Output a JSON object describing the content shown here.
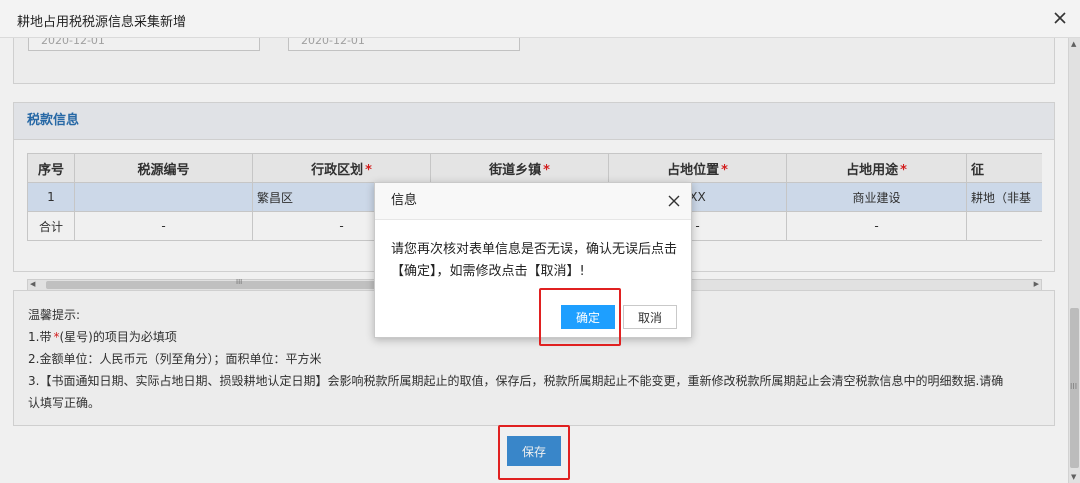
{
  "window": {
    "title": "耕地占用税税源信息采集新增"
  },
  "dates": {
    "date1": "2020-12-01",
    "date2": "2020-12-01"
  },
  "tax_section": {
    "title": "税款信息",
    "columns": [
      "序号",
      "税源编号",
      "行政区划",
      "街道乡镇",
      "占地位置",
      "占地用途",
      "征"
    ],
    "required_mark": "*",
    "rows": [
      [
        "1",
        "",
        "繁昌区",
        "",
        "XX",
        "商业建设",
        "耕地（非基"
      ],
      [
        "合计",
        "-",
        "-",
        "",
        "-",
        "-",
        ""
      ]
    ]
  },
  "scrollbar": {
    "grip": "III"
  },
  "tips": {
    "title": "温馨提示:",
    "line1_a": "1.带",
    "line1_b": "(星号)的项目为必填项",
    "line2": "2.金额单位：人民币元（列至角分）；面积单位：平方米",
    "line3": "3.【书面通知日期、实际占地日期、损毁耕地认定日期】会影响税款所属期起止的取值，保存后，税款所属期起止不能变更，重新修改税款所属期起止会清空税款信息中的明细数据.请确",
    "line4": "认填写正确。"
  },
  "save_button": "保存",
  "dialog": {
    "title": "信息",
    "message_1": "请您再次核对表单信息是否无误，确认无误后点击",
    "message_2": "【确定】，如需修改点击【取消】!",
    "ok": "确定",
    "cancel": "取消"
  },
  "colors": {
    "accent": "#1e9fff",
    "save": "#3d8fd6",
    "highlight": "#e02020",
    "required": "#e02020"
  }
}
